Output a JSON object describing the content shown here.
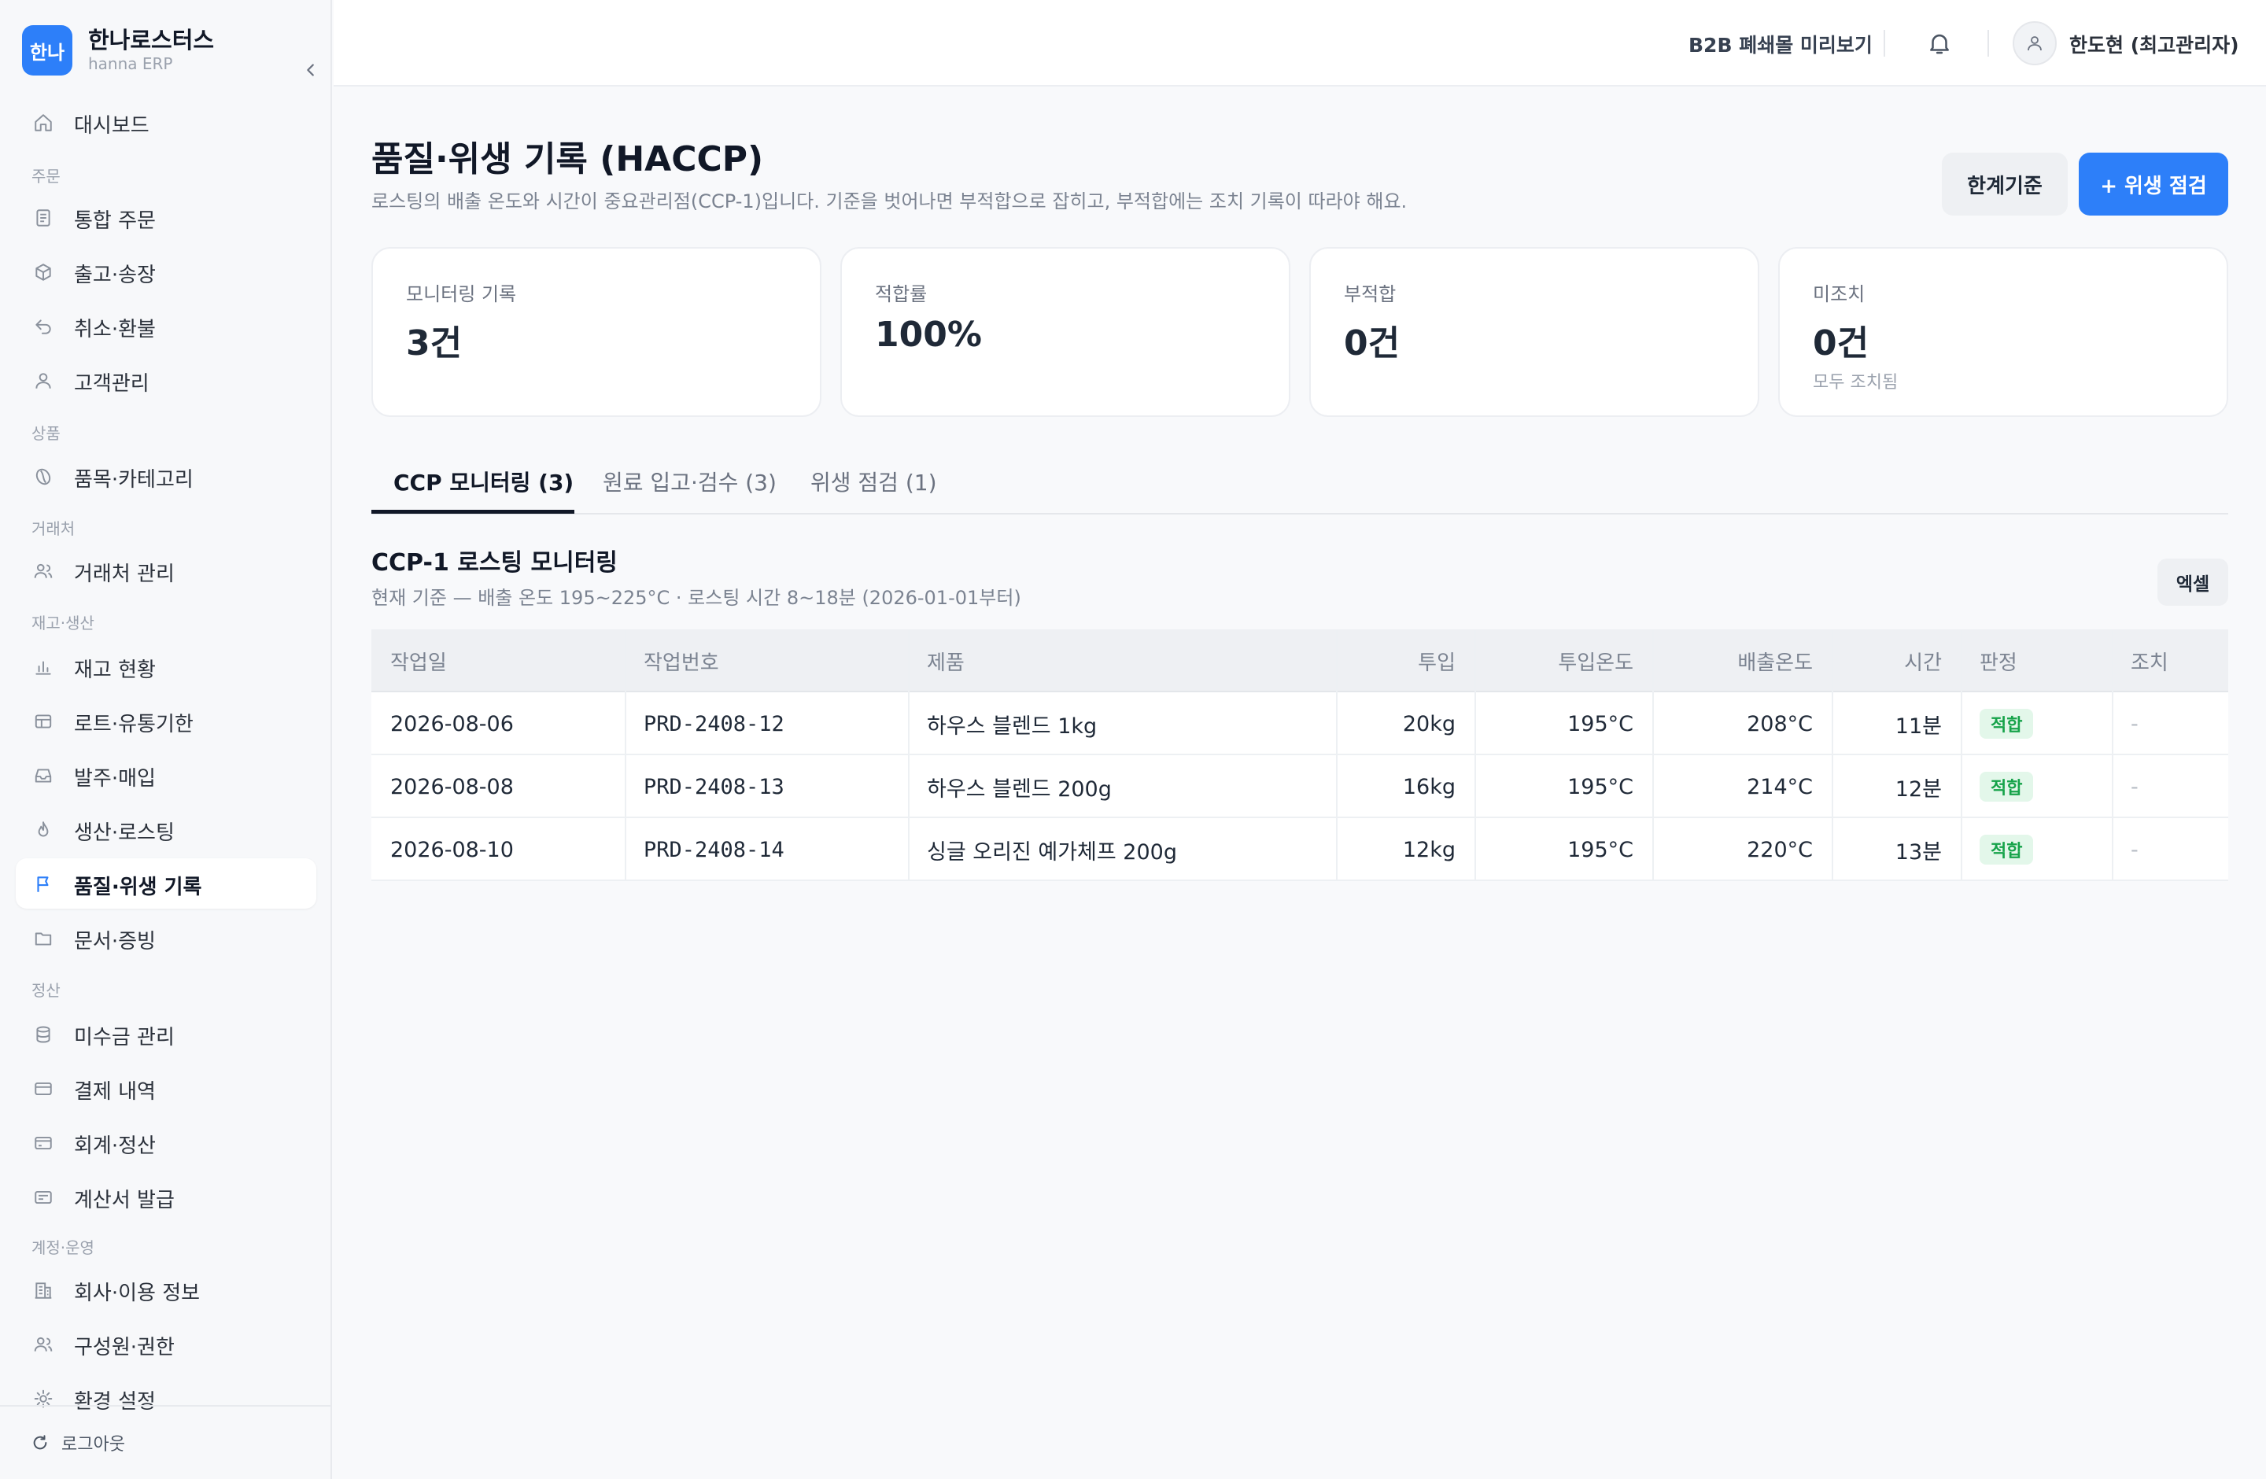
{
  "brand": {
    "logo_text": "한나",
    "name": "한나로스터스",
    "sub": "hanna ERP"
  },
  "nav": {
    "dashboard": "대시보드",
    "section_order": "주문",
    "orders": "통합 주문",
    "shipping": "출고·송장",
    "refund": "취소·환불",
    "customers": "고객관리",
    "section_product": "상품",
    "items": "품목·카테고리",
    "section_partner": "거래처",
    "partners": "거래처 관리",
    "section_stock": "재고·생산",
    "stock": "재고 현황",
    "lots": "로트·유통기한",
    "purchase": "발주·매입",
    "roasting": "생산·로스팅",
    "quality": "품질·위생 기록",
    "docs": "문서·증빙",
    "section_settle": "정산",
    "receivables": "미수금 관리",
    "payments": "결제 내역",
    "accounting": "회계·정산",
    "invoices": "계산서 발급",
    "section_account": "계정·운영",
    "company": "회사·이용 정보",
    "members": "구성원·권한",
    "settings": "환경 설정",
    "logout": "로그아웃"
  },
  "header": {
    "b2b_link": "B2B 폐쇄몰 미리보기",
    "user_name": "한도현 (최고관리자)"
  },
  "page": {
    "title": "품질·위생 기록 (HACCP)",
    "description": "로스팅의 배출 온도와 시간이 중요관리점(CCP-1)입니다. 기준을 벗어나면 부적합으로 잡히고, 부적합에는 조치 기록이 따라야 해요.",
    "btn_limit": "한계기준",
    "btn_add": "+ 위생 점검"
  },
  "stats": [
    {
      "label": "모니터링 기록",
      "value": "3건",
      "sub": ""
    },
    {
      "label": "적합률",
      "value": "100%",
      "sub": ""
    },
    {
      "label": "부적합",
      "value": "0건",
      "sub": ""
    },
    {
      "label": "미조치",
      "value": "0건",
      "sub": "모두 조치됨"
    }
  ],
  "tabs": [
    "CCP 모니터링 (3)",
    "원료 입고·검수 (3)",
    "위생 점검 (1)"
  ],
  "section": {
    "title": "CCP-1 로스팅 모니터링",
    "subtitle": "현재 기준 — 배출 온도 195~225°C · 로스팅 시간 8~18분 (2026-01-01부터)",
    "excel": "엑셀"
  },
  "table": {
    "headers": [
      "작업일",
      "작업번호",
      "제품",
      "투입",
      "투입온도",
      "배출온도",
      "시간",
      "판정",
      "조치"
    ],
    "rows": [
      [
        "2026-08-06",
        "PRD-2408-12",
        "하우스 블렌드 1kg",
        "20kg",
        "195°C",
        "208°C",
        "11분",
        "적합",
        "-"
      ],
      [
        "2026-08-08",
        "PRD-2408-13",
        "하우스 블렌드 200g",
        "16kg",
        "195°C",
        "214°C",
        "12분",
        "적합",
        "-"
      ],
      [
        "2026-08-10",
        "PRD-2408-14",
        "싱글 오리진 예가체프 200g",
        "12kg",
        "195°C",
        "220°C",
        "13분",
        "적합",
        "-"
      ]
    ]
  },
  "colors": {
    "accent": "#2d7ff9",
    "ok_bg": "#e3f7ea",
    "ok_text": "#16a34a"
  }
}
